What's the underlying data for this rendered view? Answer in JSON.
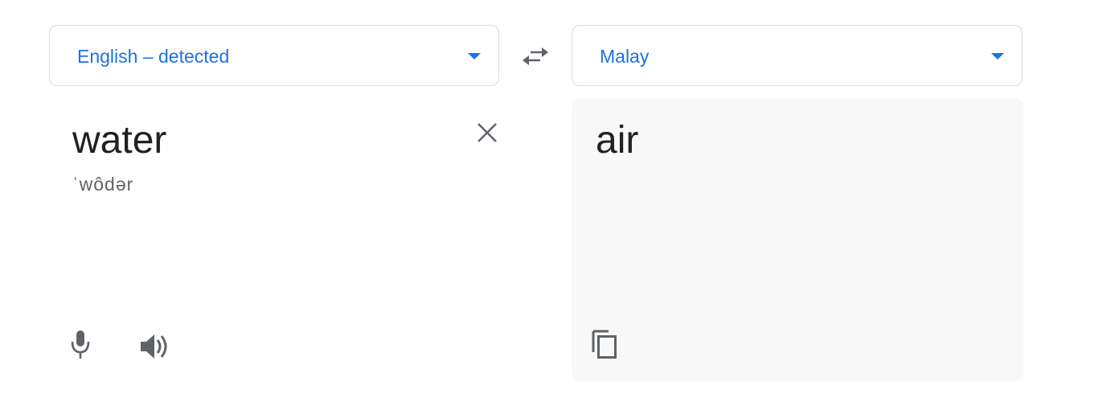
{
  "source_language": {
    "label": "English – detected"
  },
  "target_language": {
    "label": "Malay"
  },
  "source": {
    "text": "water",
    "phonetic": "ˈwôdər"
  },
  "target": {
    "text": "air"
  },
  "colors": {
    "accent": "#1a73e8",
    "icon": "#5f6368",
    "text": "#202124",
    "output_background": "#f8f8f8",
    "border": "#dadce0"
  },
  "icons": {
    "swap": "swap-arrows-icon",
    "clear": "close-icon",
    "mic": "microphone-icon",
    "speaker": "speaker-icon",
    "copy": "copy-icon",
    "dropdown": "chevron-down-icon"
  }
}
